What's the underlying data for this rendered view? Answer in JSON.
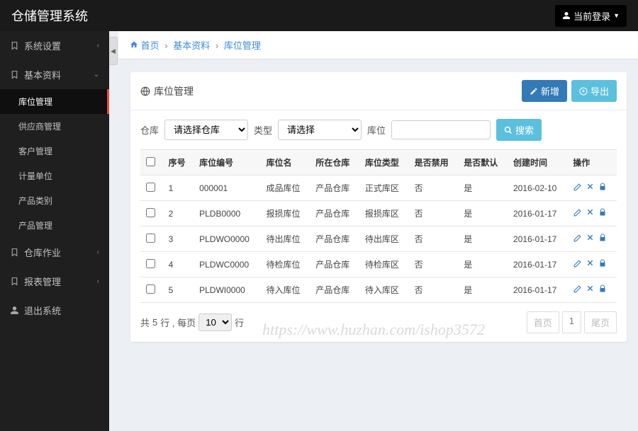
{
  "brand": "仓储管理系统",
  "topbar": {
    "login_label": "当前登录",
    "caret": "▼"
  },
  "sidebar": {
    "groups": [
      {
        "label": "系统设置",
        "expanded": false
      },
      {
        "label": "基本资料",
        "expanded": true,
        "items": [
          {
            "label": "库位管理",
            "active": true
          },
          {
            "label": "供应商管理"
          },
          {
            "label": "客户管理"
          },
          {
            "label": "计量单位"
          },
          {
            "label": "产品类别"
          },
          {
            "label": "产品管理"
          }
        ]
      },
      {
        "label": "仓库作业",
        "expanded": false
      },
      {
        "label": "报表管理",
        "expanded": false
      },
      {
        "label": "退出系统",
        "expanded": false,
        "icon": "user"
      }
    ]
  },
  "breadcrumb": {
    "home": "首页",
    "lvl1": "基本资料",
    "lvl2": "库位管理",
    "sep": "›"
  },
  "panel": {
    "title": "库位管理",
    "actions": {
      "add": "新增",
      "export": "导出"
    }
  },
  "filter": {
    "warehouse_label": "仓库",
    "warehouse_placeholder": "请选择仓库",
    "type_label": "类型",
    "type_placeholder": "请选择",
    "loc_label": "库位",
    "search_label": "搜索"
  },
  "table": {
    "headers": [
      "序号",
      "库位编号",
      "库位名",
      "所在仓库",
      "库位类型",
      "是否禁用",
      "是否默认",
      "创建时间",
      "操作"
    ],
    "rows": [
      {
        "seq": "1",
        "code": "000001",
        "name": "成品库位",
        "wh": "产品仓库",
        "type": "正式库区",
        "disabled": "否",
        "default": "是",
        "created": "2016-02-10"
      },
      {
        "seq": "2",
        "code": "PLDB0000",
        "name": "报损库位",
        "wh": "产品仓库",
        "type": "报损库区",
        "disabled": "否",
        "default": "是",
        "created": "2016-01-17"
      },
      {
        "seq": "3",
        "code": "PLDWO0000",
        "name": "待出库位",
        "wh": "产品仓库",
        "type": "待出库区",
        "disabled": "否",
        "default": "是",
        "created": "2016-01-17"
      },
      {
        "seq": "4",
        "code": "PLDWC0000",
        "name": "待检库位",
        "wh": "产品仓库",
        "type": "待检库区",
        "disabled": "否",
        "default": "是",
        "created": "2016-01-17"
      },
      {
        "seq": "5",
        "code": "PLDWI0000",
        "name": "待入库位",
        "wh": "产品仓库",
        "type": "待入库区",
        "disabled": "否",
        "default": "是",
        "created": "2016-01-17"
      }
    ]
  },
  "pager": {
    "total_prefix": "共 ",
    "total_count": "5",
    "total_mid": " 行 , 每页",
    "per_page": "10",
    "total_suffix": "行",
    "first": "首页",
    "page": "1",
    "last": "尾页"
  },
  "watermark": "https://www.huzhan.com/ishop3572"
}
